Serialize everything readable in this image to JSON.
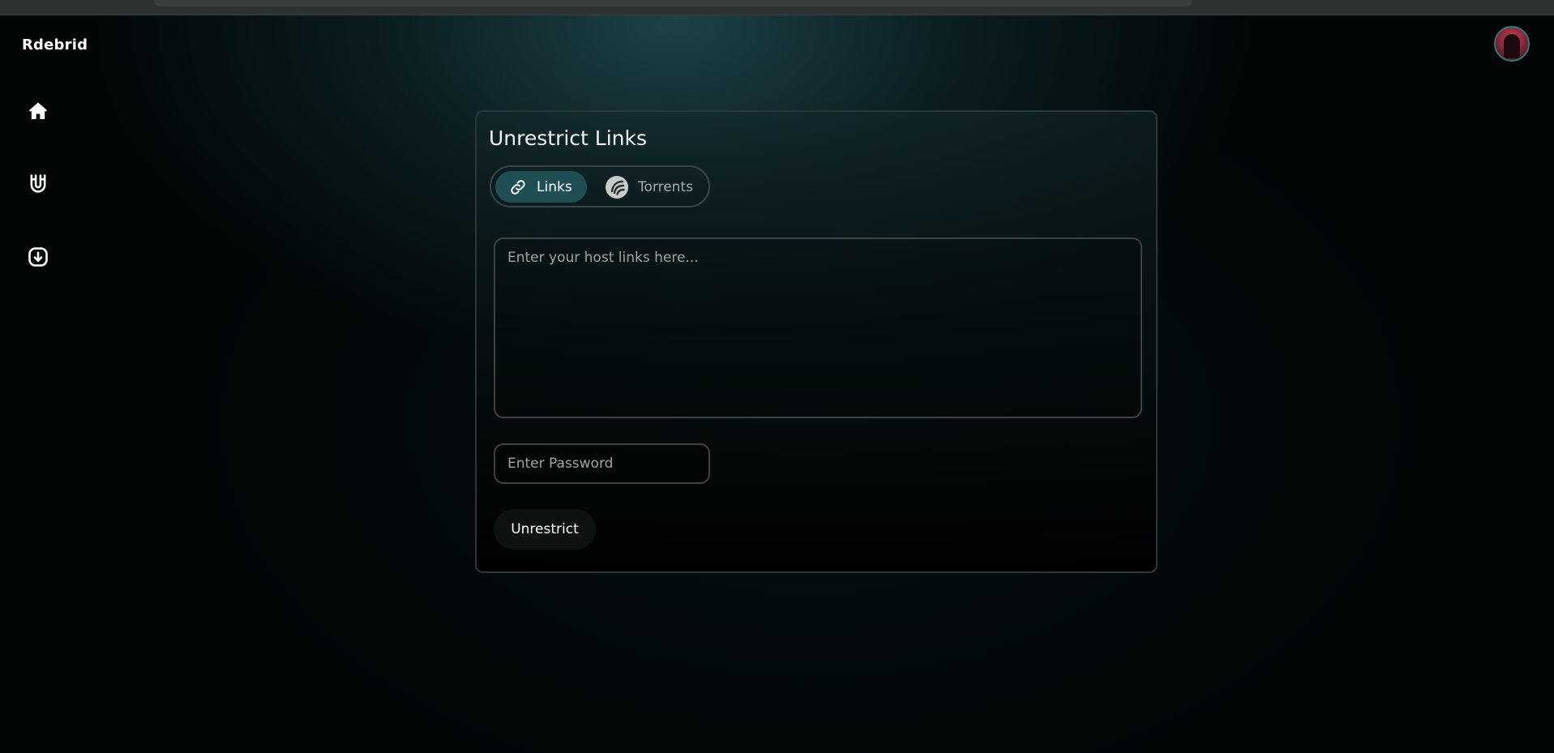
{
  "app": {
    "brand": "Rdebrid"
  },
  "sidebar": {
    "items": [
      {
        "icon": "home-icon"
      },
      {
        "icon": "magnet-icon"
      },
      {
        "icon": "download-icon"
      }
    ]
  },
  "user": {
    "avatar": "avatar"
  },
  "card": {
    "title": "Unrestrict Links",
    "tabs": [
      {
        "label": "Links",
        "icon": "link-icon",
        "active": true
      },
      {
        "label": "Torrents",
        "icon": "torrent-icon",
        "active": false
      }
    ],
    "links_input": {
      "placeholder": "Enter your host links here...",
      "value": ""
    },
    "password_input": {
      "placeholder": "Enter Password",
      "value": ""
    },
    "submit_label": "Unrestrict"
  },
  "colors": {
    "accent": "#1f4e55",
    "background": "#020607",
    "card_border": "#2a3638"
  }
}
